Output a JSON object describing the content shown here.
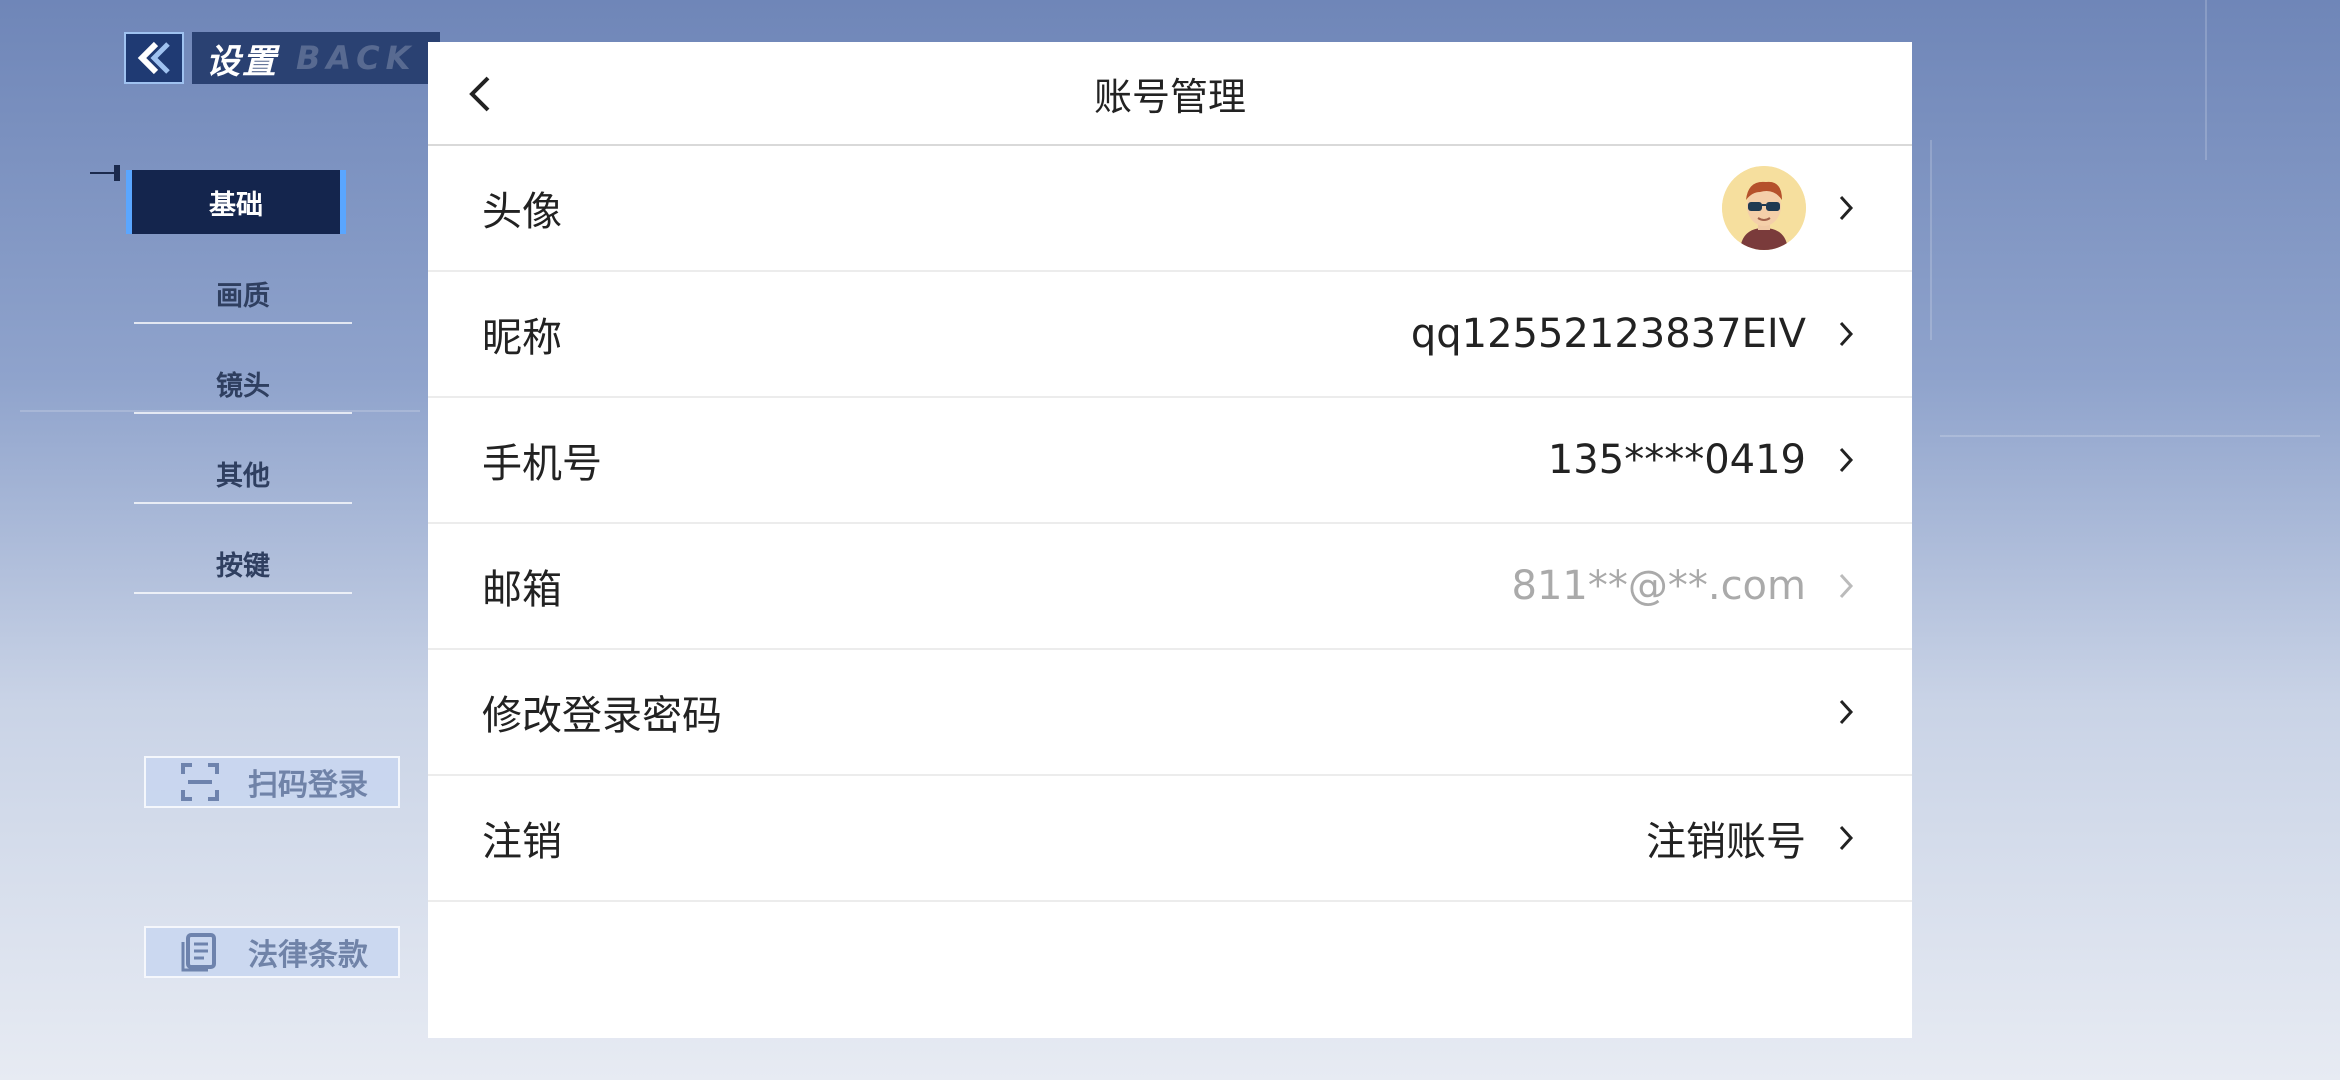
{
  "header": {
    "back_icon": "double-chevron-left-icon",
    "title": "设置",
    "watermark": "BACK"
  },
  "menu": {
    "items": [
      {
        "label": "基础",
        "active": true
      },
      {
        "label": "画质",
        "active": false
      },
      {
        "label": "镜头",
        "active": false
      },
      {
        "label": "其他",
        "active": false
      },
      {
        "label": "按键",
        "active": false
      }
    ]
  },
  "side_buttons": {
    "scan_login": {
      "label": "扫码登录",
      "icon": "scan-icon"
    },
    "legal_terms": {
      "label": "法律条款",
      "icon": "document-icon"
    }
  },
  "panel": {
    "title": "账号管理",
    "rows": [
      {
        "label": "头像",
        "type": "avatar",
        "icon": "avatar-image"
      },
      {
        "label": "昵称",
        "value": "qq12552123837EIV"
      },
      {
        "label": "手机号",
        "value": "135****0419"
      },
      {
        "label": "邮箱",
        "value": "811**@**.com",
        "muted": true
      },
      {
        "label": "修改登录密码",
        "value": ""
      },
      {
        "label": "注销",
        "value": "注销账号"
      }
    ]
  },
  "colors": {
    "accent": "#5aa6ff",
    "menu_active_bg": "#14254d",
    "muted_text": "#aaaaaa"
  }
}
